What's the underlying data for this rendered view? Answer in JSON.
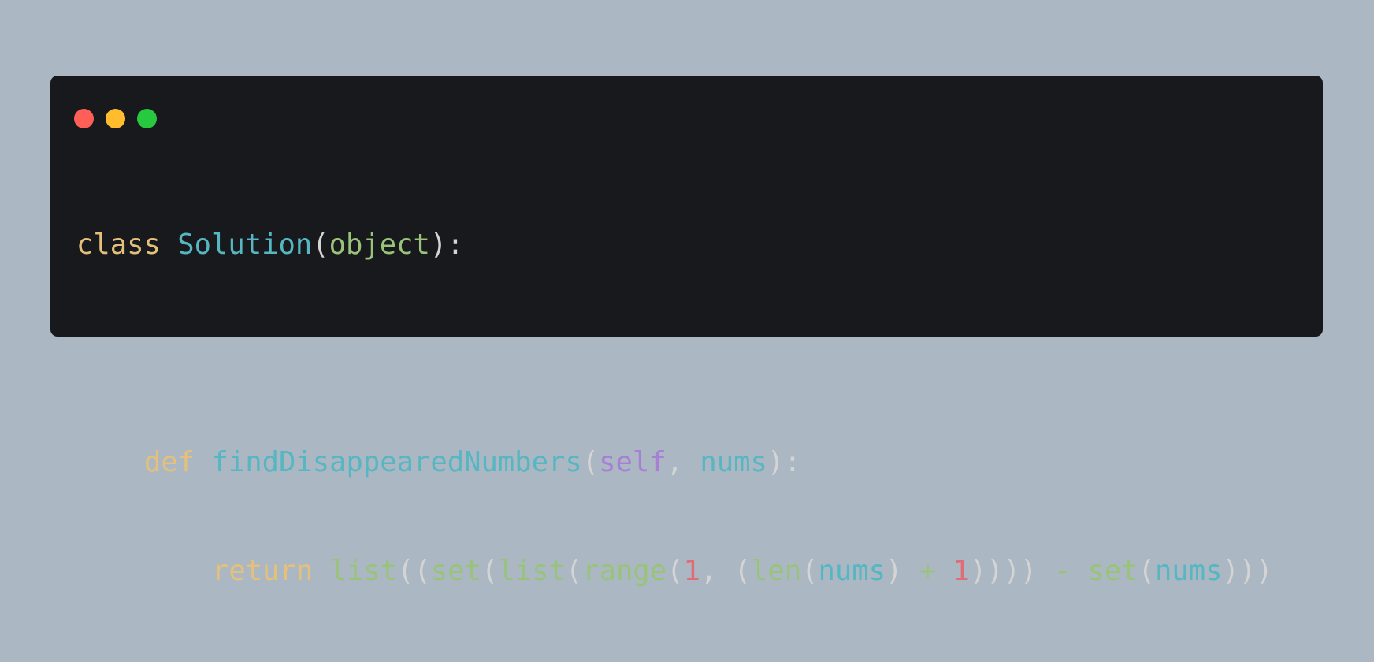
{
  "colors": {
    "background": "#abb8c3",
    "window": "#17191c",
    "dot_red": "#ff5f56",
    "dot_yellow": "#ffbd2e",
    "dot_green": "#27c93f"
  },
  "code": {
    "line1": {
      "class_kw": "class",
      "class_name": "Solution",
      "open_paren": "(",
      "base": "object",
      "close": "):"
    },
    "line2": {
      "def_kw": "def",
      "func_name": "findDisappearedNumbers",
      "open_paren": "(",
      "self_kw": "self",
      "comma": ", ",
      "param": "nums",
      "close": "):"
    },
    "line3": {
      "return_kw": "return",
      "list1": "list",
      "p1": "((",
      "set1": "set",
      "p2": "(",
      "list2": "list",
      "p3": "(",
      "range": "range",
      "p4": "(",
      "one1": "1",
      "comma": ", (",
      "len": "len",
      "p5": "(",
      "nums1": "nums",
      "p6": ") ",
      "plus": "+",
      "space1": " ",
      "one2": "1",
      "p7": ")))) ",
      "minus": "-",
      "space2": " ",
      "set2": "set",
      "p8": "(",
      "nums2": "nums",
      "p9": ")))"
    }
  }
}
